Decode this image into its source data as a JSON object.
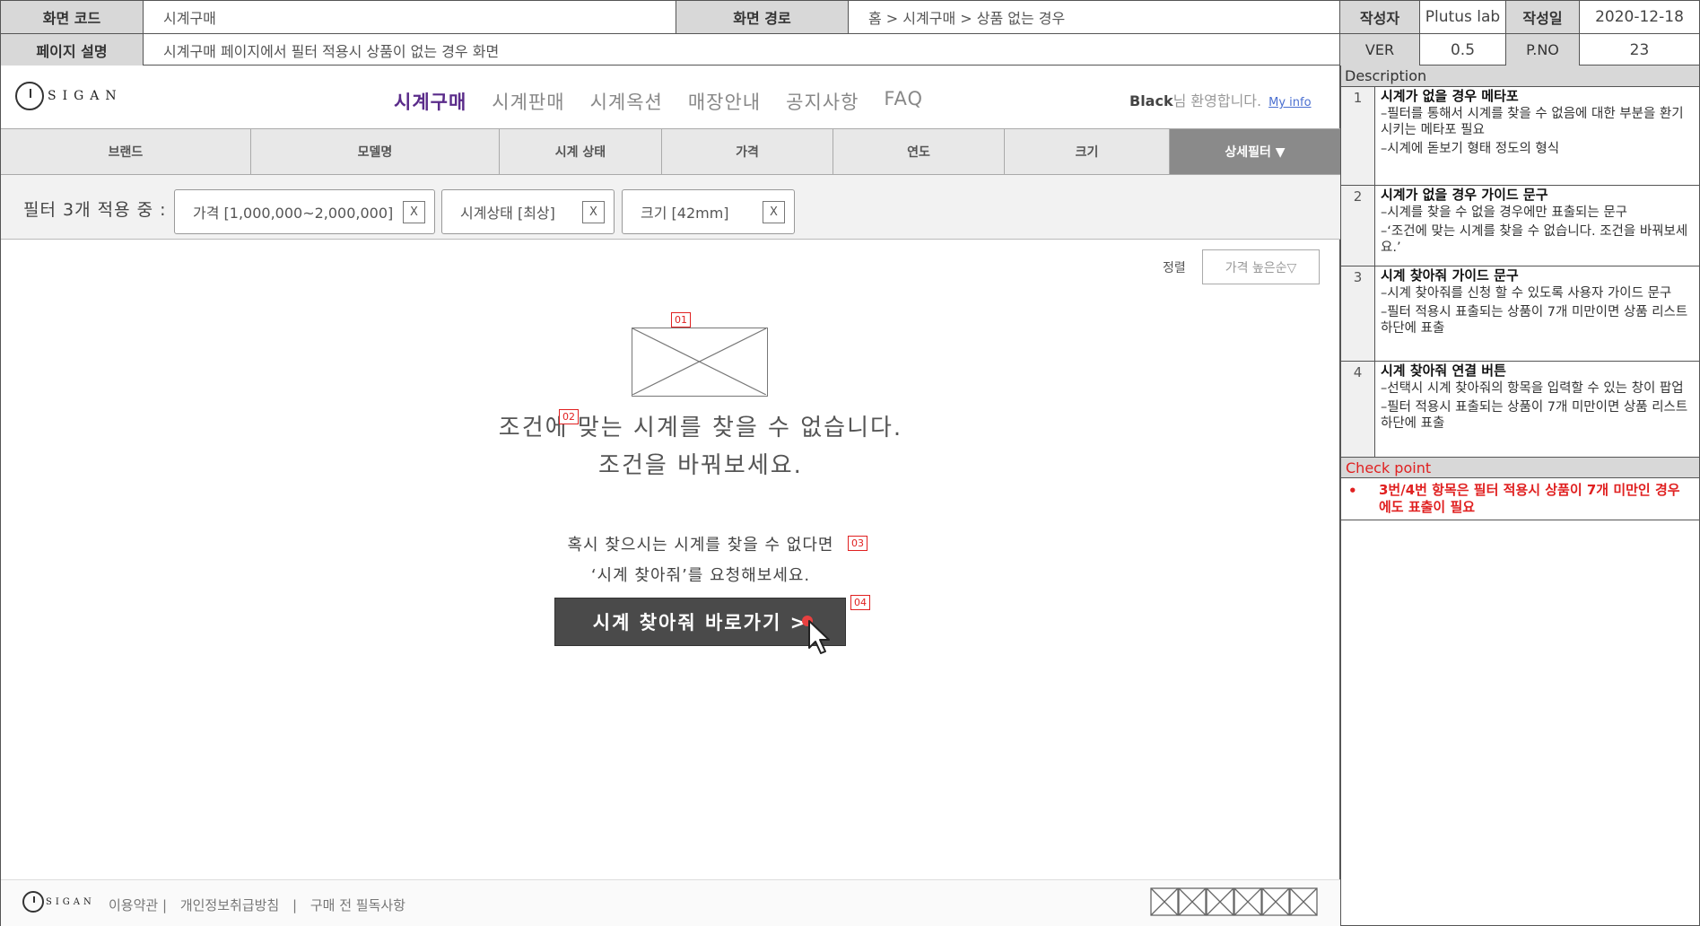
{
  "meta": {
    "screen_code_label": "화면 코드",
    "screen_code": "시계구매",
    "screen_path_label": "화면 경로",
    "screen_path": "홈 > 시계구매 > 상품 없는 경우",
    "page_desc_label": "페이지 설명",
    "page_desc": "시계구매 페이지에서 필터 적용시 상품이 없는 경우 화면",
    "author_label": "작성자",
    "author": "Plutus lab",
    "date_label": "작성일",
    "date": "2020-12-18",
    "ver_label": "VER",
    "ver": "0.5",
    "pno_label": "P.NO",
    "pno": "23"
  },
  "logo": {
    "word": "SIGAN"
  },
  "gnb": [
    "시계구매",
    "시계판매",
    "시계옥션",
    "매장안내",
    "공지사항",
    "FAQ"
  ],
  "welcome": {
    "name": "Black",
    "text": "님 환영합니다.",
    "link": "My info"
  },
  "filters": [
    "브랜드",
    "모델명",
    "시계 상태",
    "가격",
    "연도",
    "크기"
  ],
  "detail_filter": "상세필터 ▼",
  "applied": {
    "label": "필터 3개 적용 중 :",
    "chips": [
      "가격 [1,000,000~2,000,000]",
      "시계상태 [최상]",
      "크기 [42mm]"
    ],
    "remove": "X"
  },
  "sort": {
    "label": "정렬",
    "value": "가격 높은순▽"
  },
  "tags": [
    "01",
    "02",
    "03",
    "04"
  ],
  "empty": {
    "line1": "조건에 맞는 시계를 찾을 수 없습니다.",
    "line2": "조건을 바꿔보세요."
  },
  "guide": {
    "line1": "혹시 찾으시는 시계를 찾을 수 없다면",
    "line2": "‘시계 찾아줘’를 요청해보세요."
  },
  "cta": "시계 찾아줘 바로가기 >",
  "footer": {
    "links": [
      "이용약관 |",
      "개인정보취급방침",
      "|",
      "구매 전 필독사항"
    ]
  },
  "description": {
    "header": "Description",
    "items": [
      {
        "num": "1",
        "title": "시계가 없을 경우 메타포",
        "lines": [
          "–필터를 통해서 시계를 찾을 수 없음에 대한 부분을 환기 시키는 메타포 필요",
          "–시계에 돋보기 형태 정도의 형식"
        ]
      },
      {
        "num": "2",
        "title": "시계가 없을 경우 가이드 문구",
        "lines": [
          "–시계를 찾을 수 없을 경우에만 표출되는 문구",
          "–‘조건에 맞는 시계를 찾을 수 없습니다. 조건을 바꿔보세요.’"
        ]
      },
      {
        "num": "3",
        "title": "시계 찾아줘 가이드 문구",
        "lines": [
          "–시계 찾아줘를 신청 할 수 있도록 사용자 가이드 문구",
          "–필터 적용시 표출되는 상품이 7개 미만이면 상품 리스트 하단에 표출"
        ]
      },
      {
        "num": "4",
        "title": "시계 찾아줘 연결 버튼",
        "lines": [
          "–선택시 시계 찾아줘의 항목을 입력할 수 있는 창이 팝업",
          "–필터 적용시 표출되는 상품이 7개 미만이면 상품 리스트 하단에 표출"
        ]
      }
    ],
    "checkpoint_header": "Check point",
    "checkpoint": "3번/4번 항목은 필터 적용시 상품이 7개 미만인 경우에도 표출이 필요"
  }
}
